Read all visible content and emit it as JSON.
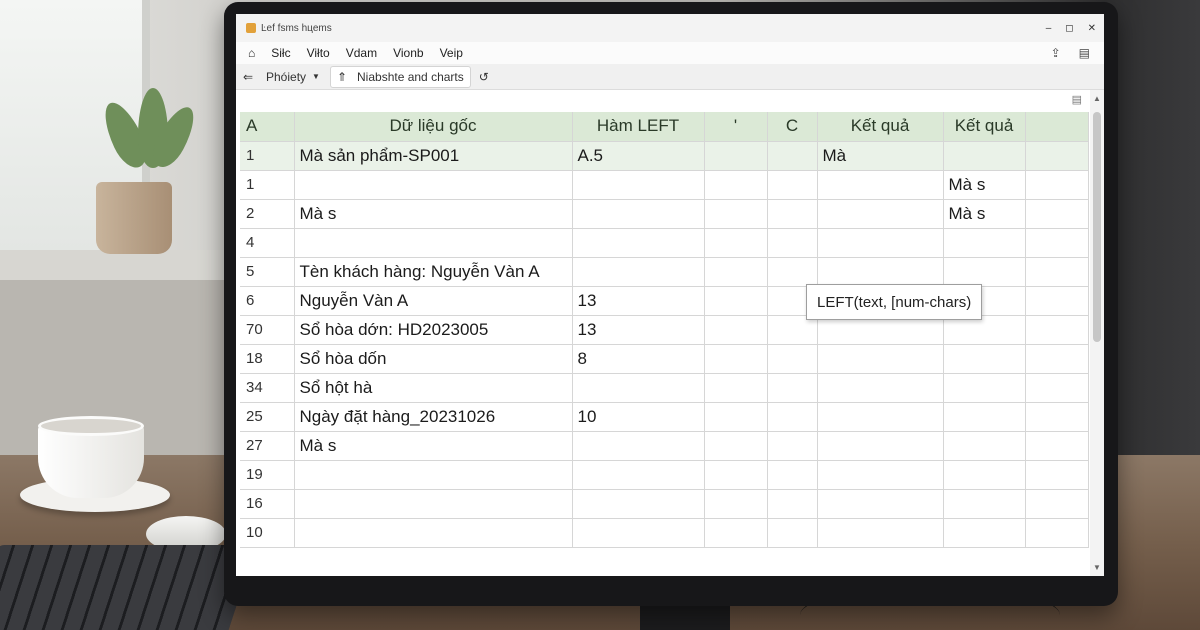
{
  "window": {
    "title": "Ŀef fsms hцems",
    "controls": {
      "minimize": "–",
      "maximize": "◻",
      "close": "✕"
    }
  },
  "menu": {
    "items": [
      "Siłc",
      "Viłto",
      "Vdam",
      "Vionb",
      "Veip"
    ],
    "share_icon": "share-icon",
    "comment_icon": "comment-icon"
  },
  "tabs": {
    "back": "⇐",
    "folder_label": "Phóiety",
    "active_tab_label": "Niabshte and charts"
  },
  "grid": {
    "header": {
      "row_label": "A",
      "columns": [
        "Dữ liệu gốc",
        "Hàm LEFT",
        "'",
        "C",
        "Kết quả",
        "Kết quả"
      ]
    },
    "rows": [
      {
        "num": "1",
        "cells": [
          "Mà sản phẩm-SP001",
          "A.5",
          "",
          "",
          "Mà",
          "",
          ""
        ]
      },
      {
        "num": "1",
        "cells": [
          "",
          "",
          "",
          "",
          "",
          "Mà s",
          ""
        ]
      },
      {
        "num": "2",
        "cells": [
          "Mà s",
          "",
          "",
          "",
          "",
          "Mà s",
          ""
        ]
      },
      {
        "num": "4",
        "cells": [
          "",
          "",
          "",
          "",
          "",
          "",
          ""
        ]
      },
      {
        "num": "5",
        "cells": [
          "Tèn khách hàng: Nguyễn Vàn A",
          "",
          "",
          "",
          "",
          "",
          ""
        ]
      },
      {
        "num": "6",
        "cells": [
          "Nguyễn Vàn A",
          "13",
          "",
          "",
          "",
          "",
          ""
        ]
      },
      {
        "num": "70",
        "cells": [
          "Sổ hòa dớn: HD2023005",
          "13",
          "",
          "",
          "",
          "",
          ""
        ]
      },
      {
        "num": "18",
        "cells": [
          "Sổ hòa dốn",
          "8",
          "",
          "",
          "",
          "",
          ""
        ]
      },
      {
        "num": "34",
        "cells": [
          "Sổ hột hà",
          "",
          "",
          "",
          "",
          "",
          ""
        ]
      },
      {
        "num": "25",
        "cells": [
          "Ngày đặt hàng_20231026",
          "10",
          "",
          "",
          "",
          "",
          ""
        ]
      },
      {
        "num": "27",
        "cells": [
          "Mà s",
          "",
          "",
          "",
          "",
          "",
          ""
        ]
      },
      {
        "num": "19",
        "cells": [
          "",
          "",
          "",
          "",
          "",
          "",
          ""
        ]
      },
      {
        "num": "16",
        "cells": [
          "",
          "",
          "",
          "",
          "",
          "",
          ""
        ]
      },
      {
        "num": "10",
        "cells": [
          "",
          "",
          "",
          "",
          "",
          "",
          ""
        ]
      }
    ]
  },
  "tooltip": {
    "text": "LEFT(text, [num-chars)"
  },
  "colors": {
    "header_green": "#dbe9d6",
    "selection_border": "#6fa26a"
  }
}
